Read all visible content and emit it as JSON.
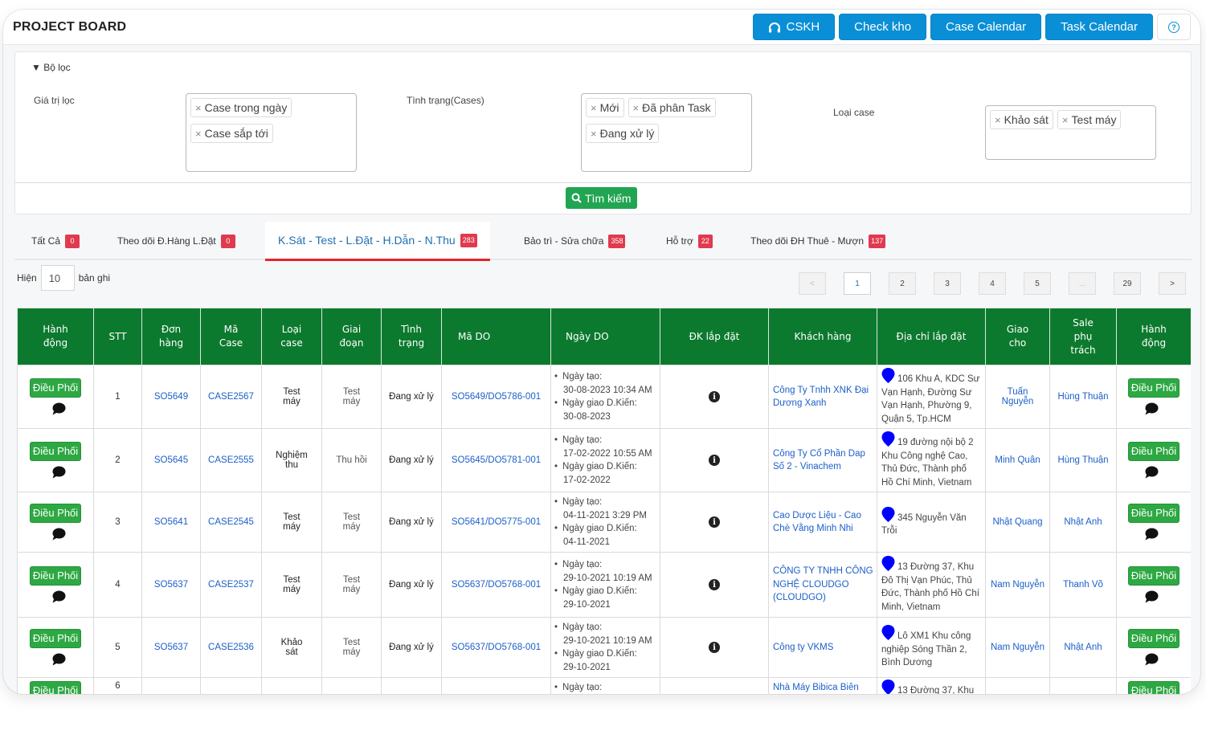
{
  "header": {
    "title": "PROJECT BOARD",
    "buttons": [
      {
        "label": "CSKH",
        "icon": "headset-icon"
      },
      {
        "label": "Check kho"
      },
      {
        "label": "Case Calendar"
      },
      {
        "label": "Task Calendar"
      }
    ],
    "help_icon": "question-circle-icon"
  },
  "filter": {
    "toggle_label": "▼ Bộ lọc",
    "groups": [
      {
        "label": "Giá trị lọc",
        "tags": [
          "Case trong ngày",
          "Case sắp tới"
        ]
      },
      {
        "label": "Tình trạng(Cases)",
        "tags": [
          "Mới",
          "Đã phân Task",
          "Đang xử lý"
        ]
      },
      {
        "label": "Loại case",
        "tags": [
          "Khảo sát",
          "Test máy"
        ]
      }
    ],
    "search_label": "Tìm kiếm",
    "tag_remove": "×"
  },
  "tabs": [
    {
      "label": "Tất Cả",
      "count": "0",
      "active": false
    },
    {
      "label": "Theo dõi Đ.Hàng L.Đặt",
      "count": "0",
      "active": false
    },
    {
      "label": "K.Sát - Test - L.Đặt - H.Dẫn - N.Thu",
      "count": "283",
      "active": true
    },
    {
      "label": "Bảo trì - Sửa chữa",
      "count": "358",
      "active": false
    },
    {
      "label": "Hỗ trợ",
      "count": "22",
      "active": false
    },
    {
      "label": "Theo dõi ĐH Thuê - Mượn",
      "count": "137",
      "active": false
    }
  ],
  "page_size": {
    "prefix": "Hiện",
    "value": "10",
    "suffix": "bản ghi"
  },
  "pagination": {
    "prev": "<",
    "next": ">",
    "pages": [
      "1",
      "2",
      "3",
      "4",
      "5",
      "...",
      "29"
    ],
    "current": "1"
  },
  "table": {
    "columns": [
      "Hành động",
      "STT",
      "Đơn hàng",
      "Mã Case",
      "Loại case",
      "Giai đoạn",
      "Tình trạng",
      "Mã DO",
      "Ngày DO",
      "ĐK lắp đặt",
      "Khách hàng",
      "Địa chỉ lắp đặt",
      "Giao cho",
      "Sale phụ trách",
      "Hành động"
    ],
    "action_label": "Điều Phối",
    "date_created_label": "Ngày tạo:",
    "date_expected_label": "Ngày giao D.Kiến:",
    "rows": [
      {
        "stt": "1",
        "order": "SO5649",
        "case": "CASE2567",
        "case_type": "Test máy",
        "stage": "Test máy",
        "status": "Đang xử lý",
        "do": "SO5649/DO5786-001",
        "created": "30-08-2023 10:34 AM",
        "expected": "30-08-2023",
        "customer": "Công Ty Tnhh XNK Đại Dương Xanh",
        "address": "106 Khu A, KDC Sư Vạn Hạnh, Đường Sư Vạn Hạnh, Phường 9, Quận 5, Tp.HCM",
        "assignee": "Tuấn Nguyễn",
        "sale": "Hùng Thuận"
      },
      {
        "stt": "2",
        "order": "SO5645",
        "case": "CASE2555",
        "case_type": "Nghiệm thu",
        "stage": "Thu hồi",
        "status": "Đang xử lý",
        "do": "SO5645/DO5781-001",
        "created": "17-02-2022 10:55 AM",
        "expected": "17-02-2022",
        "customer": "Công Ty Cổ Phần Dap Số 2 - Vinachem",
        "address": "19 đường nội bộ 2 Khu Công nghệ Cao, Thủ Đức, Thành phố Hồ Chí Minh, Vietnam",
        "assignee": "Minh Quân",
        "sale": "Hùng Thuận"
      },
      {
        "stt": "3",
        "order": "SO5641",
        "case": "CASE2545",
        "case_type": "Test máy",
        "stage": "Test máy",
        "status": "Đang xử lý",
        "do": "SO5641/DO5775-001",
        "created": "04-11-2021 3:29 PM",
        "expected": "04-11-2021",
        "customer": "Cao Dược Liệu - Cao Chè Vằng Minh Nhi",
        "address": "345 Nguyễn Văn Trỗi",
        "assignee": "Nhật Quang",
        "sale": "Nhật Anh"
      },
      {
        "stt": "4",
        "order": "SO5637",
        "case": "CASE2537",
        "case_type": "Test máy",
        "stage": "Test máy",
        "status": "Đang xử lý",
        "do": "SO5637/DO5768-001",
        "created": "29-10-2021 10:19 AM",
        "expected": "29-10-2021",
        "customer": "CÔNG TY TNHH CÔNG NGHỆ CLOUDGO (CLOUDGO)",
        "address": "13 Đường 37, Khu Đô Thị Vạn Phúc, Thủ Đức, Thành phố Hồ Chí Minh, Vietnam",
        "assignee": "Nam Nguyễn",
        "sale": "Thanh Võ"
      },
      {
        "stt": "5",
        "order": "SO5637",
        "case": "CASE2536",
        "case_type": "Khảo sát",
        "stage": "Test máy",
        "status": "Đang xử lý",
        "do": "SO5637/DO5768-001",
        "created": "29-10-2021 10:19 AM",
        "expected": "29-10-2021",
        "customer": "Công ty VKMS",
        "address": "Lô XM1 Khu công nghiệp Sóng Thần 2, Bình Dương",
        "assignee": "Nam Nguyễn",
        "sale": "Nhật Anh"
      },
      {
        "stt": "6",
        "order": "",
        "case": "",
        "case_type": "",
        "stage": "",
        "status": "",
        "do": "",
        "created": "",
        "expected": "",
        "customer": "Nhà Máy Bibica Biên",
        "address": "13 Đường 37, Khu",
        "assignee": "",
        "sale": ""
      }
    ]
  },
  "colors": {
    "primary_blue": "#0a8fd6",
    "table_header_green": "#0c7a2e",
    "action_green": "#2ea843",
    "badge_red": "#e03a4e",
    "link_blue": "#1c5fc9",
    "pin_blue": "#0000ff",
    "active_tab_underline": "#e5252a"
  }
}
